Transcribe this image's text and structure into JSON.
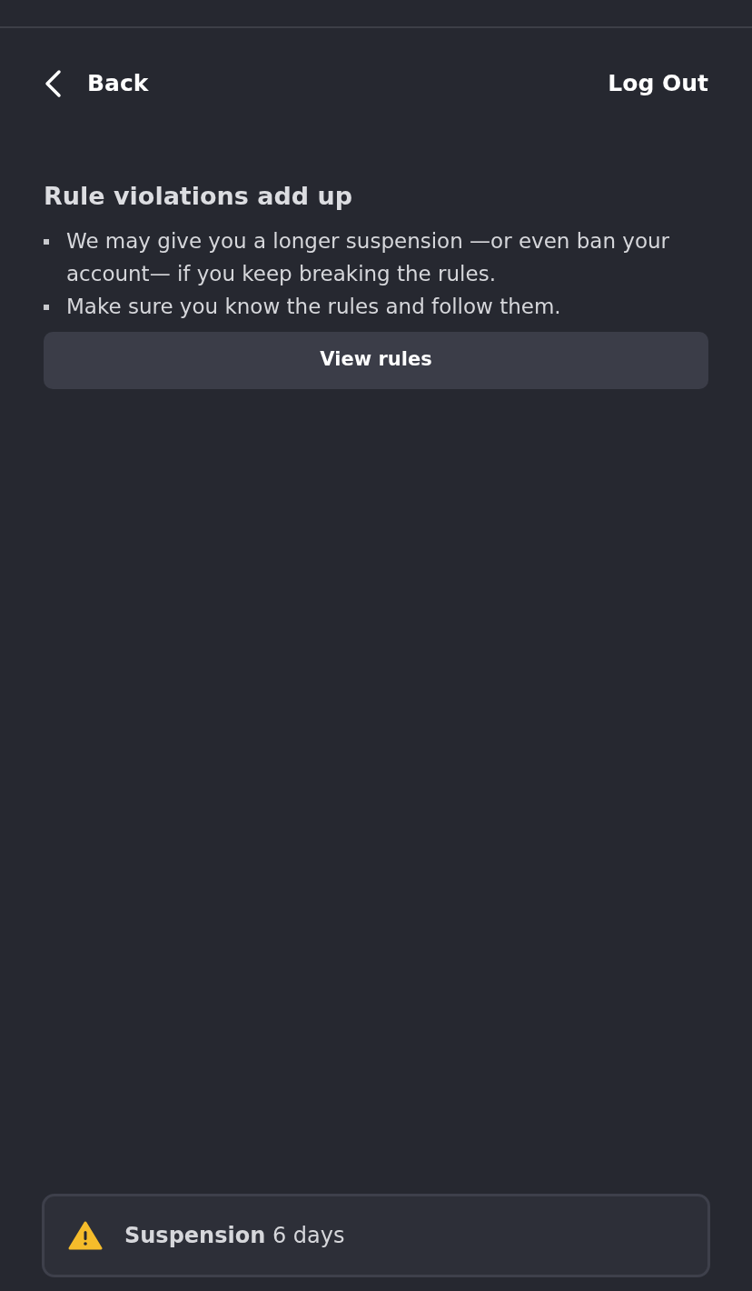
{
  "nav": {
    "back": "Back",
    "logout": "Log Out"
  },
  "section": {
    "title": "Rule violations add up",
    "bullets": [
      "We may give you a longer suspension —or even ban your account— if you keep breaking the rules.",
      "Make sure you know the rules and follow them."
    ],
    "button": "View rules"
  },
  "status": {
    "text": "**Suspension** 6 days"
  }
}
